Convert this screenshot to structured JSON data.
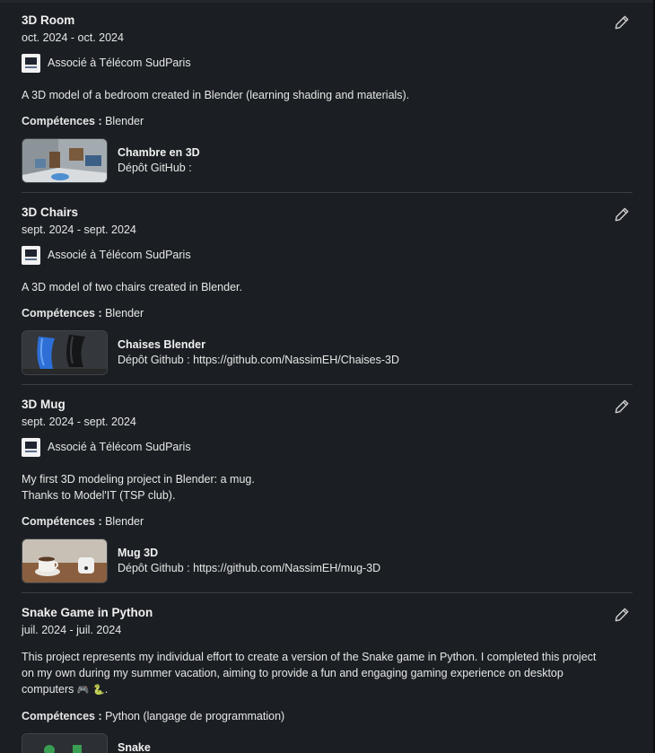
{
  "projects": [
    {
      "title": "3D Room",
      "dates": "oct. 2024 - oct. 2024",
      "association": "Associé à Télécom SudParis",
      "description_lines": [
        "A 3D model of a bedroom created in Blender (learning shading and materials)."
      ],
      "skills_label": "Compétences :",
      "skills": " Blender",
      "media_title": "Chambre en 3D",
      "media_subtitle": "Dépôt GitHub :"
    },
    {
      "title": "3D Chairs",
      "dates": "sept. 2024 - sept. 2024",
      "association": "Associé à Télécom SudParis",
      "description_lines": [
        "A 3D model of two chairs created in Blender."
      ],
      "skills_label": "Compétences :",
      "skills": " Blender",
      "media_title": "Chaises Blender",
      "media_subtitle": "Dépôt Github : https://github.com/NassimEH/Chaises-3D"
    },
    {
      "title": "3D Mug",
      "dates": "sept. 2024 - sept. 2024",
      "association": "Associé à Télécom SudParis",
      "description_lines": [
        "My first 3D modeling project in Blender: a mug.",
        "Thanks to Model'IT (TSP club)."
      ],
      "skills_label": "Compétences :",
      "skills": " Blender",
      "media_title": "Mug 3D",
      "media_subtitle": "Dépôt Github : https://github.com/NassimEH/mug-3D"
    },
    {
      "title": "Snake Game in Python",
      "dates": "juil. 2024 - juil. 2024",
      "description_lines": [
        "This project represents my individual effort to create a version of the Snake game in Python. I completed this project",
        "on my own during my summer vacation, aiming to provide a fun and engaging gaming experience on desktop",
        "computers"
      ],
      "emoji_game": "🎮",
      "emoji_snake": "🐍",
      "desc_end": ".",
      "skills_label": "Compétences :",
      "skills": " Python (langage de programmation)",
      "media_title": "Snake"
    }
  ],
  "icons": {
    "edit": "pencil-icon",
    "logo": "telecom-sudparis-logo"
  },
  "colors": {
    "background": "#1b1f23",
    "divider": "#3a3e44",
    "text": "#e6e6e6"
  }
}
